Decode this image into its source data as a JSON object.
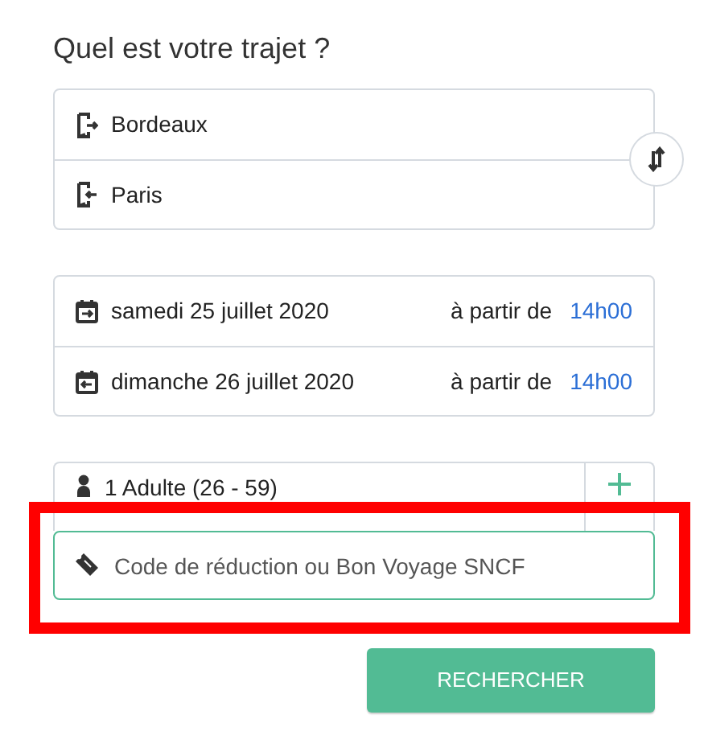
{
  "title": "Quel est votre trajet ?",
  "route": [
    {
      "kind": "origin",
      "label": "Bordeaux"
    },
    {
      "kind": "destination",
      "label": "Paris"
    }
  ],
  "dates": [
    {
      "kind": "outbound",
      "date": "samedi 25 juillet 2020",
      "from_label": "à partir de",
      "time": "14h00"
    },
    {
      "kind": "return",
      "date": "dimanche 26 juillet 2020",
      "from_label": "à partir de",
      "time": "14h00"
    }
  ],
  "passengers": {
    "label": "1 Adulte (26 - 59)"
  },
  "promo": {
    "placeholder": "Code de réduction ou Bon Voyage SNCF"
  },
  "search_button": "RECHERCHER"
}
